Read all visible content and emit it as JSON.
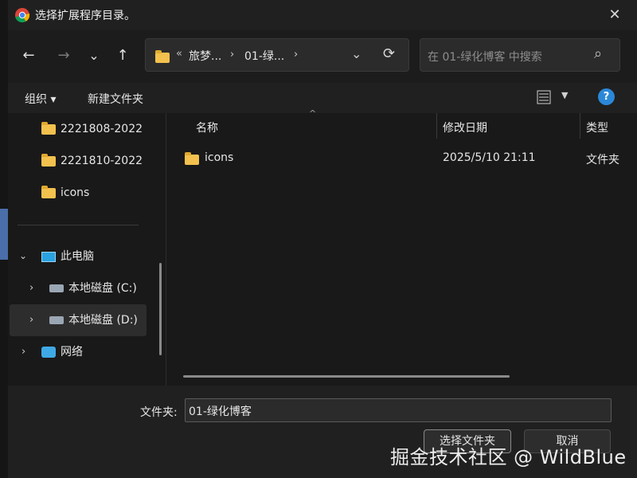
{
  "window": {
    "title": "选择扩展程序目录。"
  },
  "nav": {
    "breadcrumb": [
      {
        "label": "旅梦..."
      },
      {
        "label": "01-绿..."
      }
    ],
    "overflow": "«",
    "search_placeholder": "在 01-绿化博客 中搜索"
  },
  "toolbar": {
    "organize": "组织 ▾",
    "new_folder": "新建文件夹"
  },
  "tree": {
    "folders": [
      "2221808-2022",
      "2221810-2022",
      "icons"
    ],
    "this_pc": "此电脑",
    "drives": [
      "本地磁盘 (C:)",
      "本地磁盘 (D:)"
    ],
    "network": "网络"
  },
  "columns": {
    "name": "名称",
    "modified": "修改日期",
    "type": "类型"
  },
  "files": [
    {
      "name": "icons",
      "modified": "2025/5/10 21:11",
      "type": "文件夹"
    }
  ],
  "footer": {
    "folder_label": "文件夹:",
    "folder_value": "01-绿化博客",
    "select_button": "选择文件夹",
    "cancel_button": "取消"
  },
  "watermark": "掘金技术社区 @ WildBlue",
  "icons": {
    "help": "?",
    "back": "←",
    "forward": "→",
    "down": "⌄",
    "up": "↑",
    "refresh": "⟳",
    "search": "⌕",
    "close": "✕"
  },
  "colors": {
    "accent": "#2b88d8",
    "folder": "#f2c14e"
  }
}
